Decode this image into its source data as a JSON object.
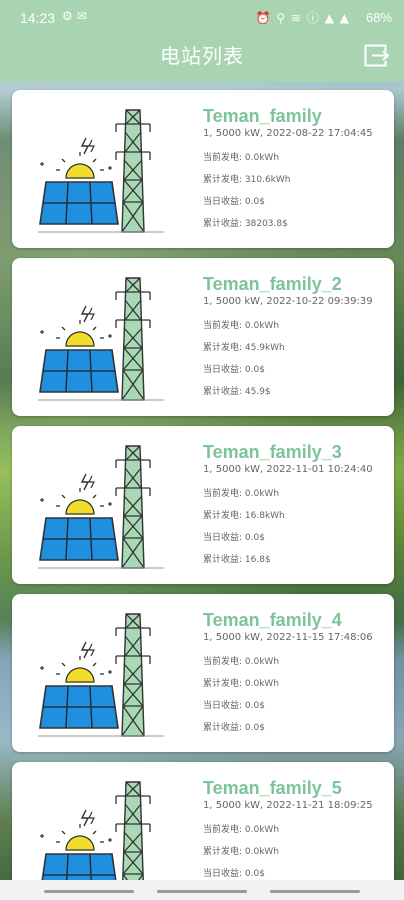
{
  "status": {
    "time": "14:23",
    "left_icons": "⚙ ✉",
    "right_icons": "⏰ ⚲ ≋ ⓘ ▲ ▲",
    "battery": "68%"
  },
  "header": {
    "title": "电站列表"
  },
  "labels": {
    "current_power": "当前发电: ",
    "total_power": "累计发电: ",
    "today_income": "当日收益: ",
    "total_income": "累计收益: "
  },
  "stations": [
    {
      "name": "Teman_family",
      "meta": "1, 5000 kW, 2022-08-22 17:04:45",
      "current_power": "0.0kWh",
      "total_power": "310.6kWh",
      "today_income": "0.0$",
      "total_income": "38203.8$"
    },
    {
      "name": "Teman_family_2",
      "meta": "1, 5000 kW, 2022-10-22 09:39:39",
      "current_power": "0.0kWh",
      "total_power": "45.9kWh",
      "today_income": "0.0$",
      "total_income": "45.9$"
    },
    {
      "name": "Teman_family_3",
      "meta": "1, 5000 kW, 2022-11-01 10:24:40",
      "current_power": "0.0kWh",
      "total_power": "16.8kWh",
      "today_income": "0.0$",
      "total_income": "16.8$"
    },
    {
      "name": "Teman_family_4",
      "meta": "1, 5000 kW, 2022-11-15 17:48:06",
      "current_power": "0.0kWh",
      "total_power": "0.0kWh",
      "today_income": "0.0$",
      "total_income": "0.0$"
    },
    {
      "name": "Teman_family_5",
      "meta": "1, 5000 kW, 2022-11-21 18:09:25",
      "current_power": "0.0kWh",
      "total_power": "0.0kWh",
      "today_income": "0.0$",
      "total_income": ""
    }
  ],
  "colors": {
    "accent": "#7cc49a",
    "appbar": "#a9d4b2",
    "panel": "#1f8fe0",
    "tower": "#a8d8b4",
    "sun": "#f2dc2c"
  }
}
